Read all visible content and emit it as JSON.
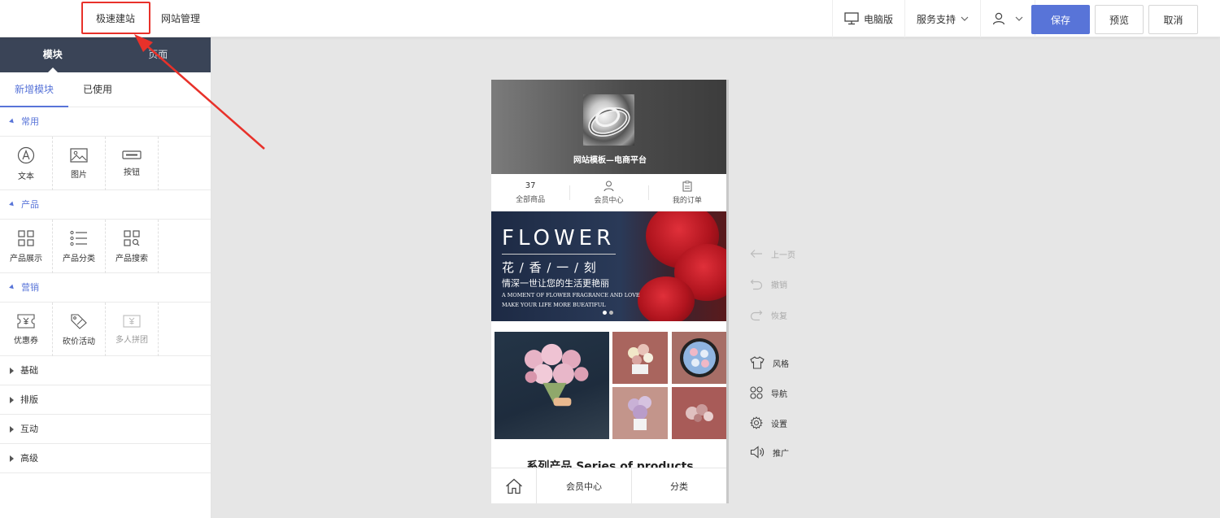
{
  "topbar": {
    "tabs": [
      "极速建站",
      "网站管理"
    ],
    "right": {
      "desktop": "电脑版",
      "support": "服务支持"
    },
    "buttons": {
      "save": "保存",
      "preview": "预览",
      "cancel": "取消"
    }
  },
  "sidebar": {
    "tabs": [
      "模块",
      "页面"
    ],
    "sub_tabs": [
      "新增模块",
      "已使用"
    ],
    "categories": [
      {
        "name": "常用",
        "expanded": true,
        "items": [
          {
            "label": "文本",
            "icon": "text-icon"
          },
          {
            "label": "图片",
            "icon": "image-icon"
          },
          {
            "label": "按钮",
            "icon": "button-icon"
          }
        ]
      },
      {
        "name": "产品",
        "expanded": true,
        "items": [
          {
            "label": "产品展示",
            "icon": "grid-icon"
          },
          {
            "label": "产品分类",
            "icon": "list-icon"
          },
          {
            "label": "产品搜索",
            "icon": "grid-search-icon"
          }
        ]
      },
      {
        "name": "营销",
        "expanded": true,
        "items": [
          {
            "label": "优惠券",
            "icon": "coupon-icon"
          },
          {
            "label": "砍价活动",
            "icon": "tag-discount-icon"
          },
          {
            "label": "多人拼团",
            "icon": "group-buy-icon"
          }
        ]
      },
      {
        "name": "基础",
        "expanded": false
      },
      {
        "name": "排版",
        "expanded": false
      },
      {
        "name": "互动",
        "expanded": false
      },
      {
        "name": "高级",
        "expanded": false
      }
    ]
  },
  "phone": {
    "site_title": "网站模板—电商平台",
    "stats": [
      {
        "value": "37",
        "label": "全部商品"
      },
      {
        "label": "会员中心",
        "icon": "user-icon"
      },
      {
        "label": "我的订单",
        "icon": "clipboard-icon"
      }
    ],
    "banner": {
      "en": "FLOWER",
      "cn": "花 / 香 / 一 / 刻",
      "sub": "情深一世让您的生活更艳丽",
      "en_line1": "A MOMENT OF FLOWER FRAGRANCE AND LOVE",
      "en_line2": "MAKE YOUR LIFE MORE BUEATIFUL"
    },
    "series_title": "系列产品 Series of products",
    "footer": {
      "member": "会员中心",
      "category": "分类"
    }
  },
  "tools": {
    "prev": "上一页",
    "undo": "撤销",
    "redo": "恢复",
    "style": "风格",
    "nav": "导航",
    "settings": "设置",
    "promote": "推广"
  },
  "colors": {
    "primary": "#5874d8",
    "sidebar_header": "#3a4457",
    "highlight": "#e8312a"
  }
}
